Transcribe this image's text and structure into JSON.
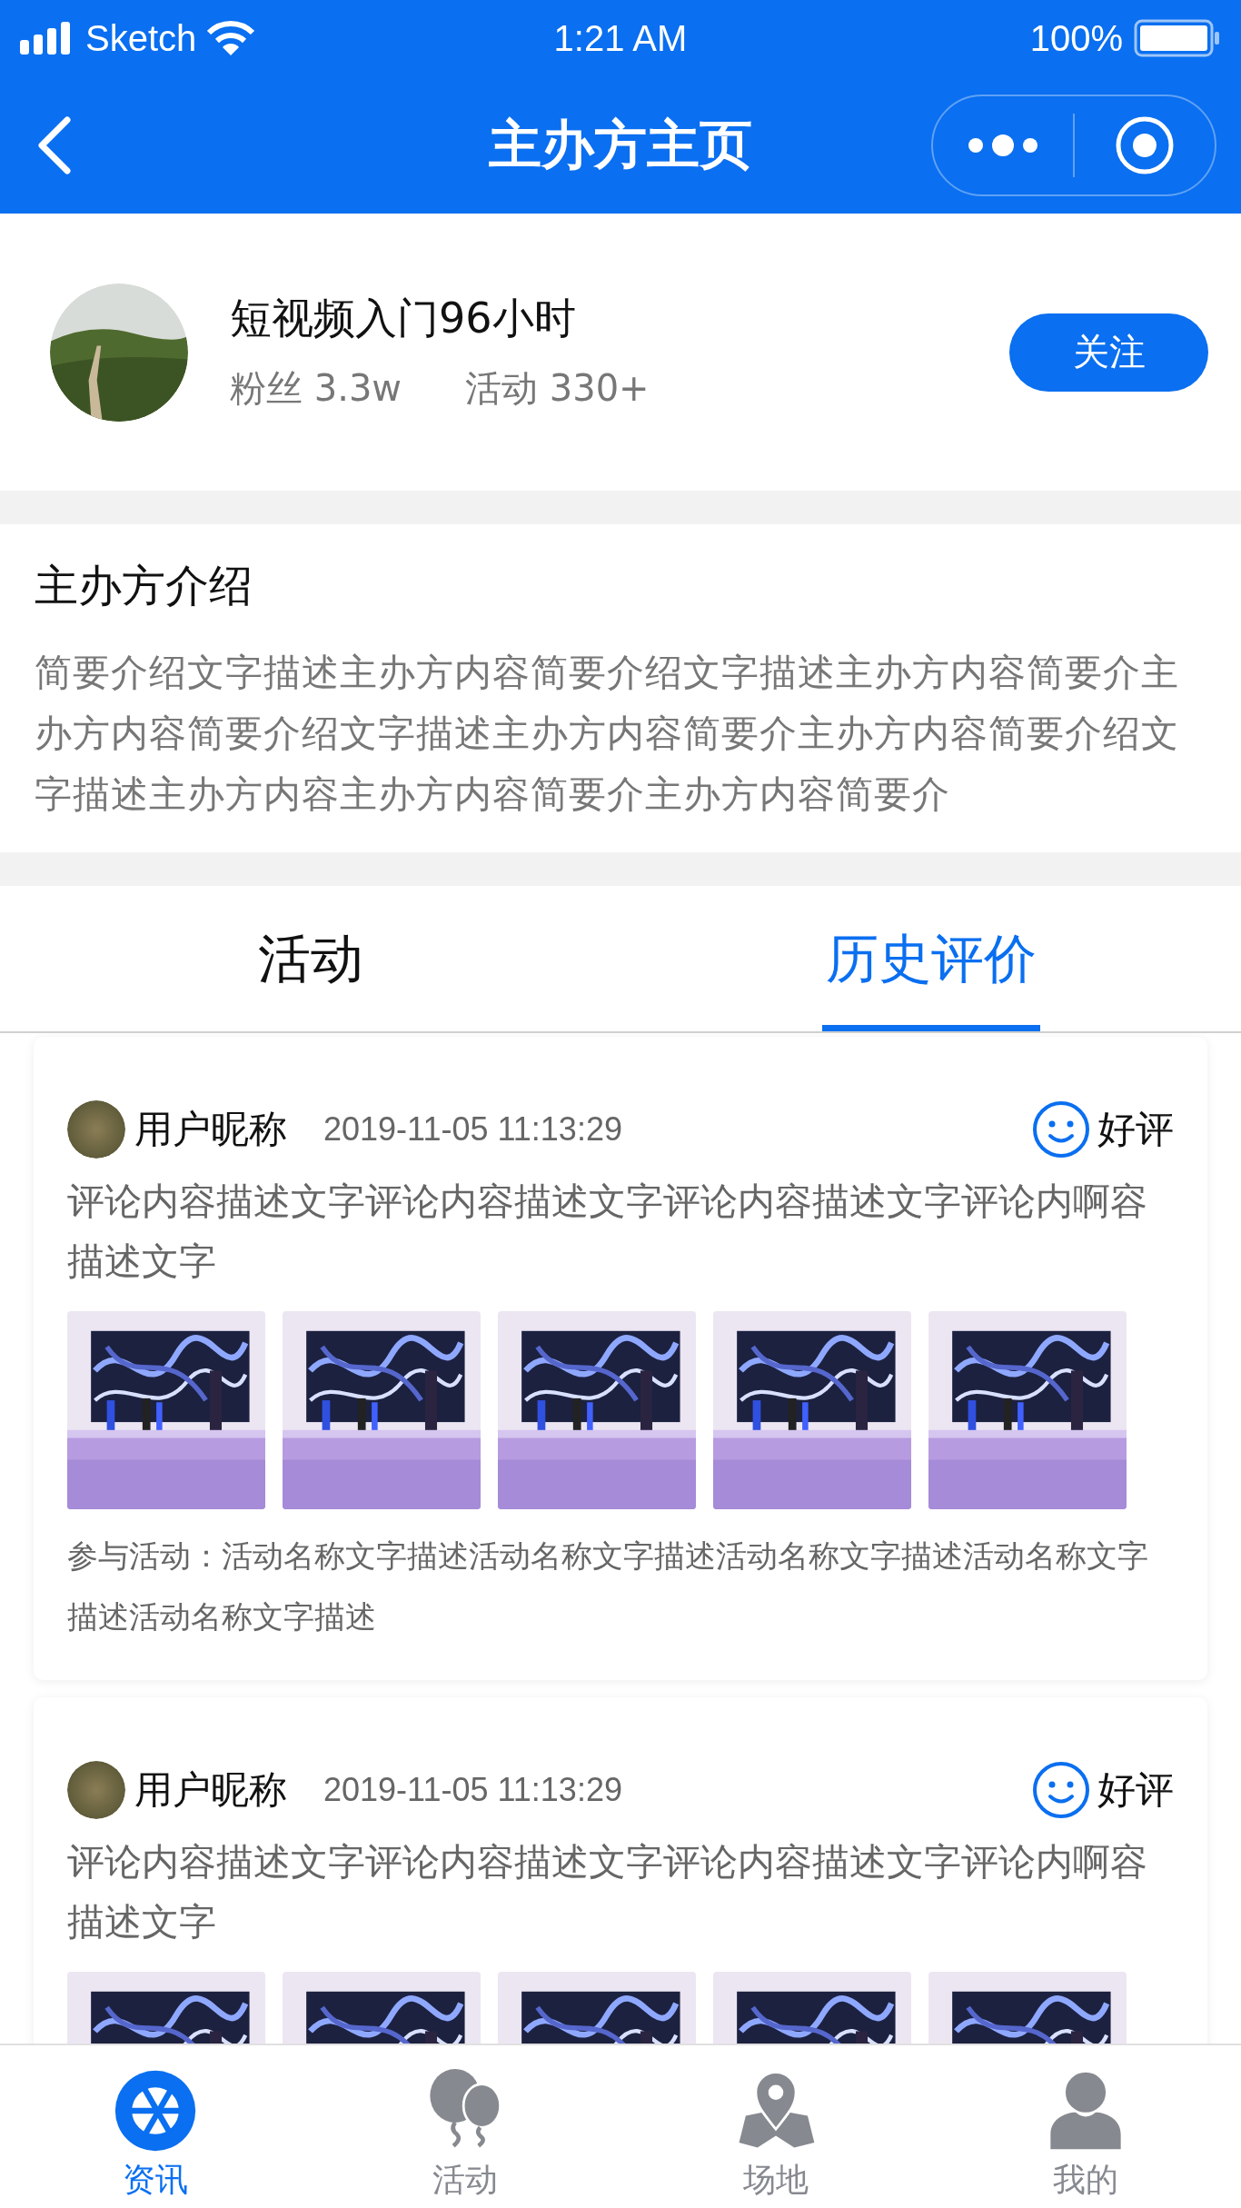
{
  "status_bar": {
    "carrier": "Sketch",
    "time": "1:21 AM",
    "battery": "100%"
  },
  "nav": {
    "title": "主办方主页"
  },
  "organizer": {
    "name": "短视频入门96小时",
    "stats": [
      {
        "label": "粉丝",
        "value": "3.3w"
      },
      {
        "label": "活动",
        "value": "330+"
      }
    ],
    "follow_button": "关注"
  },
  "intro": {
    "title": "主办方介绍",
    "text": "简要介绍文字描述主办方内容简要介绍文字描述主办方内容简要介主办方内容简要介绍文字描述主办方内容简要介主办方内容简要介绍文字描述主办方内容主办方内容简要介主办方内容简要介"
  },
  "tabs": [
    {
      "label": "活动",
      "selected": false
    },
    {
      "label": "历史评价",
      "selected": true
    }
  ],
  "reviews": [
    {
      "user": "用户昵称",
      "time": "2019-11-05 11:13:29",
      "rating": "好评",
      "comment": "评论内容描述文字评论内容描述文字评论内容描述文字评论内啊容描述文字",
      "activity": "参与活动：活动名称文字描述活动名称文字描述活动名称文字描述活动名称文字描述活动名称文字描述"
    },
    {
      "user": "用户昵称",
      "time": "2019-11-05 11:13:29",
      "rating": "好评",
      "comment": "评论内容描述文字评论内容描述文字评论内容描述文字评论内啊容描述文字"
    }
  ],
  "bottom_nav": [
    {
      "label": "资讯",
      "selected": true
    },
    {
      "label": "活动",
      "selected": false
    },
    {
      "label": "场地",
      "selected": false
    },
    {
      "label": "我的",
      "selected": false
    }
  ]
}
